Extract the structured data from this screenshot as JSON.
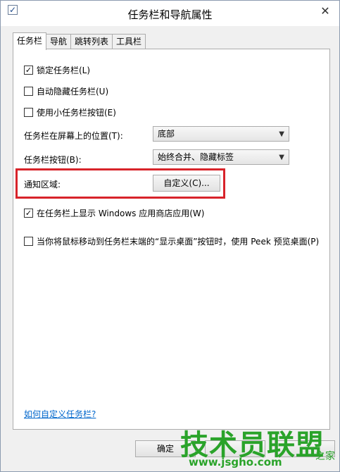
{
  "window": {
    "title": "任务栏和导航属性",
    "close_glyph": "✕",
    "app_icon_glyph": "✓"
  },
  "tabs": [
    {
      "label": "任务栏",
      "active": true
    },
    {
      "label": "导航",
      "active": false
    },
    {
      "label": "跳转列表",
      "active": false
    },
    {
      "label": "工具栏",
      "active": false
    }
  ],
  "taskbar": {
    "lock_taskbar": {
      "label": "锁定任务栏(L)",
      "checked": true,
      "mark": "✓"
    },
    "auto_hide": {
      "label": "自动隐藏任务栏(U)",
      "checked": false,
      "mark": ""
    },
    "small_buttons": {
      "label": "使用小任务栏按钮(E)",
      "checked": false,
      "mark": ""
    },
    "location": {
      "label": "任务栏在屏幕上的位置(T):",
      "value": "底部"
    },
    "buttons": {
      "label": "任务栏按钮(B):",
      "value": "始终合并、隐藏标签"
    },
    "notification_area": {
      "label": "通知区域:",
      "button": "自定义(C)..."
    },
    "show_store_apps": {
      "label": "在任务栏上显示 Windows 应用商店应用(W)",
      "checked": true,
      "mark": "✓"
    },
    "peek": {
      "label": "当你将鼠标移动到任务栏末端的“显示桌面”按钮时，使用 Peek 预览桌面(P)",
      "checked": false,
      "mark": ""
    },
    "help_link": "如何自定义任务栏?"
  },
  "dialog_buttons": {
    "ok": "确定"
  },
  "watermark": {
    "brand": "技术员联盟",
    "url": "www.jsgho.com",
    "tail": "之家"
  },
  "colors": {
    "highlight_box": "#d8232a",
    "link": "#0066cc",
    "watermark": "#2aa32a"
  },
  "icons": {
    "app": "checkbox-app-icon",
    "close": "close-icon",
    "dropdown": "chevron-down-icon"
  }
}
